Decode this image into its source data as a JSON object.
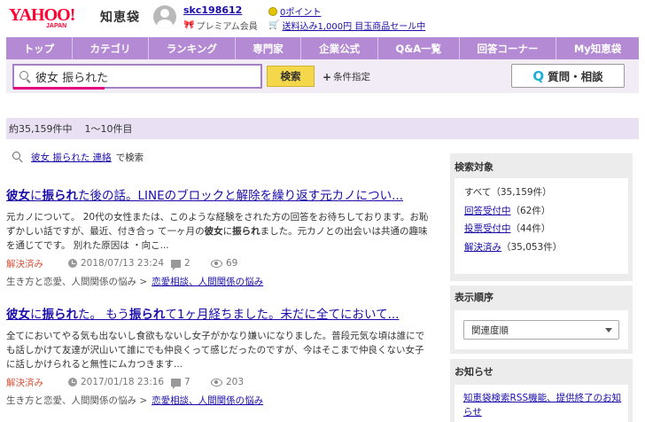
{
  "header": {
    "logo_main": "YAHOO!",
    "logo_sub": "JAPAN",
    "service_name": "知恵袋",
    "username": "skc198612",
    "premium_label": "プレミアム会員",
    "points_label": "0ポイント",
    "promo_label": "送料込み1,000円 目玉商品セール中"
  },
  "nav": {
    "items": [
      {
        "label": "トップ"
      },
      {
        "label": "カテゴリ"
      },
      {
        "label": "ランキング"
      },
      {
        "label": "専門家"
      },
      {
        "label": "企業公式"
      },
      {
        "label": "Q&A一覧"
      },
      {
        "label": "回答コーナー"
      },
      {
        "label": "My知恵袋"
      }
    ]
  },
  "search": {
    "query": "彼女 振られた",
    "submit_label": "検索",
    "condition_label": "条件指定",
    "ask_label": "質問・相談",
    "ask_q": "Q"
  },
  "results_summary": {
    "total": "約35,159件中",
    "range": "1〜10件目"
  },
  "search_hint": {
    "query_link": "彼女 振られた 連絡",
    "suffix": "で検索"
  },
  "results": [
    {
      "title": "彼女に振られた後の話。LINEのブロックと解除を繰り返す元カノについ...",
      "snippet": "元カノについて。 20代の女性または、このような経験をされた方の回答をお待ちしております。お恥ずかしい話ですが、最近、付き合っ て一ヶ月の彼女に振られました。元カノとの出会いは共通の趣味を通じてです。 別れた原因は ・向こ...",
      "status": "解決済み",
      "date": "2018/07/13 23:24",
      "answers": "2",
      "views": "69",
      "category_path": "生き方と恋愛、人間関係の悩み >",
      "category_link": "恋愛相談、人間関係の悩み"
    },
    {
      "title": "彼女に振られた。 もう振られて1ヶ月経ちました。未だに全てにおいて...",
      "snippet": "全てにおいてやる気も出ないし食欲もないし女子がかなり嫌いになりました。普段元気な頃は誰にでも話しかけて友達が沢山いて誰にでも仲良くって感じだったのですが、今はそこまで仲良くない女子に話しかけられると無性にムカつきます...",
      "status": "解決済み",
      "date": "2017/01/18 23:16",
      "answers": "7",
      "views": "203",
      "category_path": "生き方と恋愛、人間関係の悩み >",
      "category_link": "恋愛相談、人間関係の悩み"
    }
  ],
  "sidebar": {
    "filter_title": "検索対象",
    "filters": [
      {
        "label": "すべて",
        "count": "（35,159件）"
      },
      {
        "label": "回答受付中",
        "count": "（62件）"
      },
      {
        "label": "投票受付中",
        "count": "（44件）"
      },
      {
        "label": "解決済み",
        "count": "（35,053件）"
      }
    ],
    "sort_title": "表示順序",
    "sort_selected": "関連度順",
    "notice_title": "お知らせ",
    "notice_link": "知恵袋検索RSS機能、提供終了のお知らせ"
  },
  "colors": {
    "nav_bg": "#b48ad4",
    "count_bar_bg": "#eae0f4",
    "search_button": "#f5d74b",
    "link": "#1a0dab",
    "solved": "#d8543a",
    "highlight_underline": "#e5007f"
  }
}
